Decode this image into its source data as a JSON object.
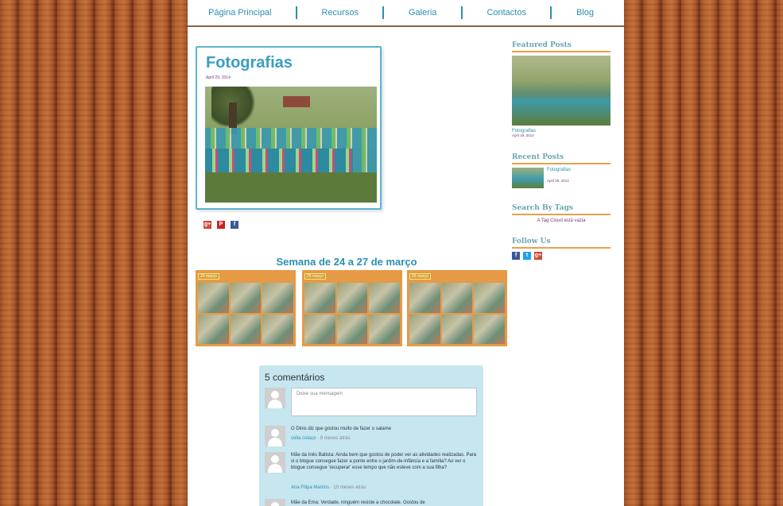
{
  "nav": {
    "items": [
      "Página Principal",
      "Recursos",
      "Galeria",
      "Contactos",
      "Blog"
    ]
  },
  "post": {
    "title": "Fotografias",
    "date": "April 29, 2014"
  },
  "share": {
    "icons": [
      "google-plus-icon",
      "pinterest-icon",
      "facebook-icon"
    ],
    "colors": [
      "#d14836",
      "#cb2027",
      "#3b5998"
    ],
    "glyphs": [
      "g+",
      "P",
      "f"
    ]
  },
  "week": {
    "title": "Semana de 24 a 27 de março",
    "thumbs": [
      "24 março",
      "25 março",
      "26 março"
    ]
  },
  "comments": {
    "heading": "5 comentários",
    "placeholder": "Deixe sua mensagem",
    "items": [
      {
        "text": "O Dinis diz que gostou muito de fazer o salame",
        "author": "celia colaço",
        "ago": "9 meses atrás"
      },
      {
        "text": "Mãe da Inês Batista: Ainda bem que gostou de poder ver as atividades realizadas. Para si o blogue consegue fazer a ponte entre o jardim-de-infância e a família? Ao ver o blogue consegue 'recuperar' esse tempo que não esteve com a sua filha?",
        "author": "Ana Filipa Martins",
        "ago": "10 meses atrás"
      },
      {
        "text": "Mãe da Ema: Verdade, ninguém resiste a chocolate. Gostou de",
        "author": "",
        "ago": ""
      }
    ]
  },
  "sidebar": {
    "featured_title": "Featured Posts",
    "featured_link": "Fotografias",
    "featured_date": "April 29, 2014",
    "recent_title": "Recent Posts",
    "recent_link": "Fotografias",
    "recent_date": "April 29, 2014",
    "tags_title": "Search By Tags",
    "tags_empty": "A Tag Cloud está vazia",
    "follow_title": "Follow Us",
    "follow_icons": [
      "facebook-icon",
      "twitter-icon",
      "google-plus-icon"
    ],
    "follow_colors": [
      "#3b5998",
      "#1da1f2",
      "#d14836"
    ],
    "follow_glyphs": [
      "f",
      "t",
      "g+"
    ]
  }
}
